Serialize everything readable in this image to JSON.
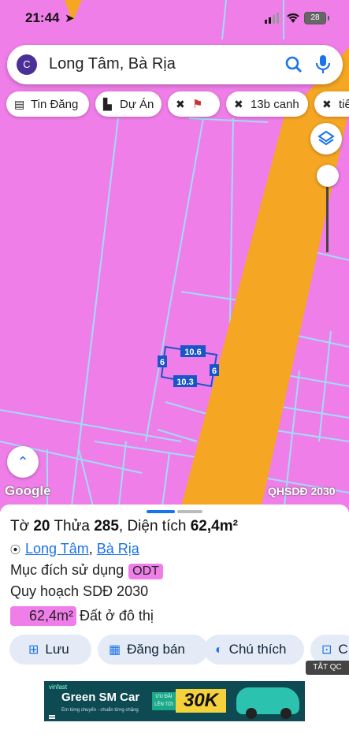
{
  "status_bar": {
    "time": "21:44",
    "battery": "28"
  },
  "search": {
    "avatar_letter": "C",
    "query": "Long Tâm, Bà Rịa"
  },
  "chips": [
    {
      "label": "Tin Đăng",
      "icon": "news-icon"
    },
    {
      "label": "Dự Án",
      "icon": "building-icon"
    },
    {
      "label": "",
      "icon": "tools-icon"
    },
    {
      "label": "13b canh",
      "icon": "tools-icon"
    },
    {
      "label": "tiế",
      "icon": "tools-icon"
    }
  ],
  "map": {
    "parcel_top": "10.6",
    "parcel_bottom": "10.3",
    "parcel_left": "6",
    "parcel_right": "6",
    "google_label": "Google",
    "overlay_label": "QHSDĐ 2030",
    "colors": {
      "residential": "#f07ee9",
      "road": "#f5a623",
      "lines": "#8fd3f4"
    }
  },
  "panel": {
    "title_parts": {
      "sheet_label": "Tờ",
      "sheet": "20",
      "plot_label": "Thửa",
      "plot": "285",
      "area_label": "Diện tích",
      "area": "62,4m²"
    },
    "title_sep": ",",
    "location": {
      "ward": "Long Tâm",
      "city": "Bà Rịa"
    },
    "purpose_label": "Mục đích sử dụng",
    "purpose_code": "ODT",
    "plan_label": "Quy hoạch SDĐ 2030",
    "area_value": "62,4m²",
    "area_desc": "Đất ở đô thị",
    "actions": [
      {
        "label": "Lưu",
        "icon": "save-icon"
      },
      {
        "label": "Đăng bán",
        "icon": "listing-icon"
      },
      {
        "label": "Chú thích",
        "icon": "contrast-icon"
      },
      {
        "label": "C",
        "icon": "add-photo-icon"
      }
    ],
    "ad_tag": "TẮT QC",
    "ad": {
      "brand": "vinfast",
      "headline": "Green SM Car",
      "tagline": "Em từng chuyến - chuẩn từng chặng",
      "promo_label": "ƯU ĐÃI LÊN TỚI",
      "promo_value": "30K"
    }
  }
}
